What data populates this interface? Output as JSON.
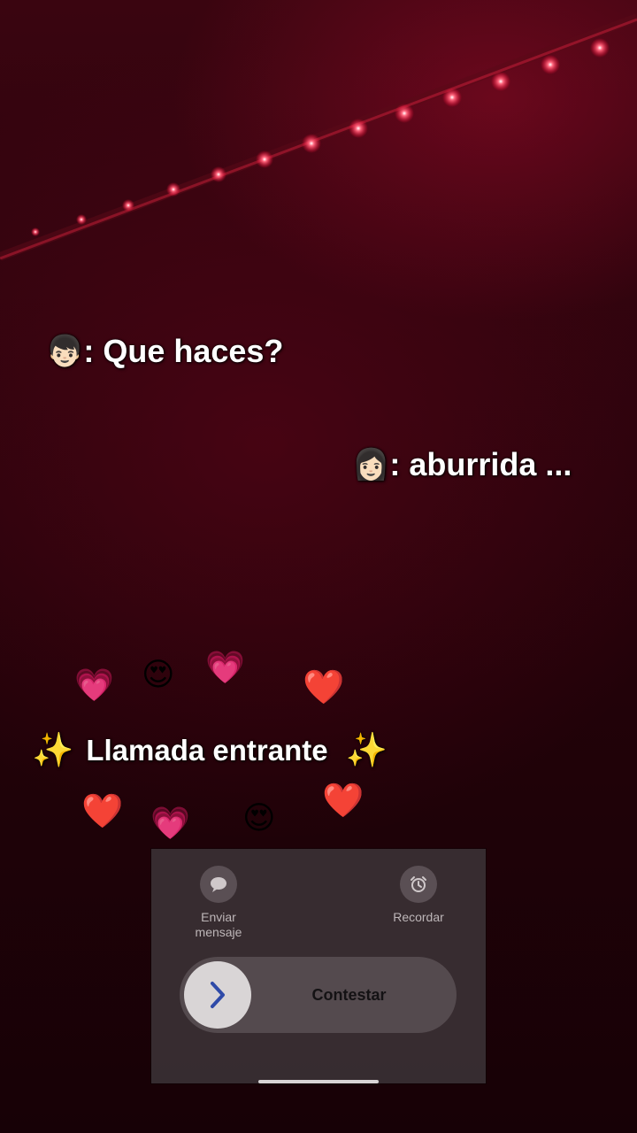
{
  "captions": {
    "line1": {
      "avatar": "👦🏻",
      "text": ": Que haces?"
    },
    "line2": {
      "avatar": "👩🏻",
      "text": ": aburrida ..."
    }
  },
  "incoming": {
    "sparkle": "✨",
    "text": "Llamada entrante"
  },
  "emojis": {
    "pink_heart": "💗",
    "heart_eyes": "😍",
    "red_heart": "❤️"
  },
  "call_panel": {
    "message_label_1": "Enviar",
    "message_label_2": "mensaje",
    "remind_label": "Recordar",
    "answer_label": "Contestar",
    "message_icon": "speech-bubble-icon",
    "remind_icon": "alarm-clock-icon",
    "answer_icon": "chevron-right-icon"
  },
  "colors": {
    "background": "#2a030c",
    "led": "#ff2a4a",
    "panel": "#3a3034",
    "chevron": "#2f4aa8"
  }
}
